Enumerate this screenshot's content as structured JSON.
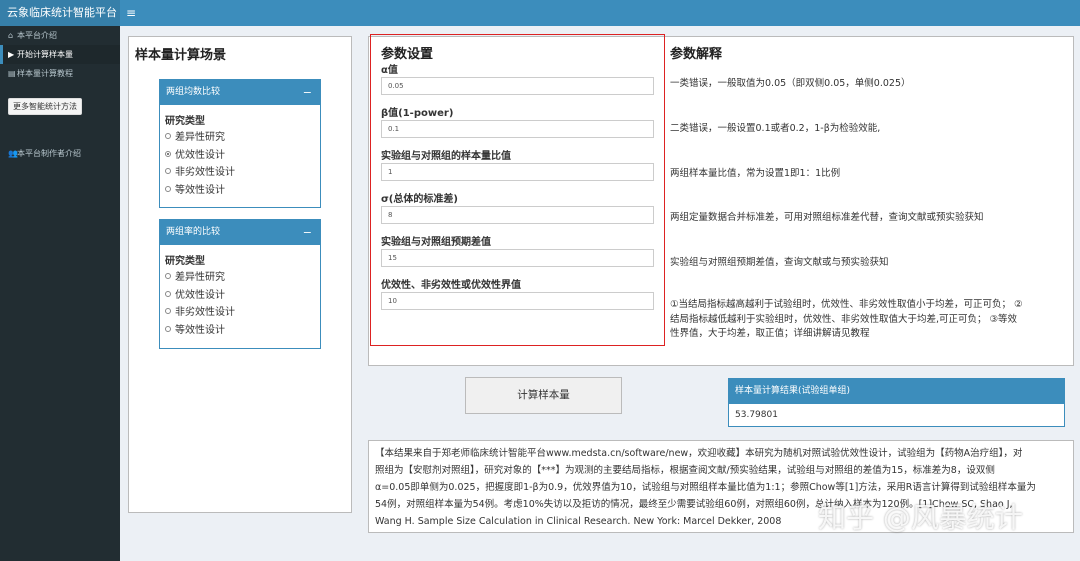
{
  "app": {
    "title": "云象临床统计智能平台",
    "menu_icon": "≡"
  },
  "sidebar": {
    "items": [
      {
        "icon": "⌂",
        "label": "本平台介绍"
      },
      {
        "icon": "▶",
        "label": "开始计算样本量"
      },
      {
        "icon": "▤",
        "label": "样本量计算教程"
      }
    ],
    "more_button": "更多智能统计方法",
    "author": {
      "icon": "👥",
      "label": "本平台制作者介绍"
    }
  },
  "scenario": {
    "title": "样本量计算场景",
    "box1": {
      "header": "两组均数比较",
      "study_type_label": "研究类型",
      "options": [
        "差异性研究",
        "优效性设计",
        "非劣效性设计",
        "等效性设计"
      ],
      "selected": 1
    },
    "box2": {
      "header": "两组率的比较",
      "study_type_label": "研究类型",
      "options": [
        "差异性研究",
        "优效性设计",
        "非劣效性设计",
        "等效性设计"
      ],
      "selected": -1
    }
  },
  "params": {
    "title": "参数设置",
    "fields": [
      {
        "label": "α值",
        "value": "0.05"
      },
      {
        "label": "β值(1-power)",
        "value": "0.1"
      },
      {
        "label": "实验组与对照组的样本量比值",
        "value": "1"
      },
      {
        "label": "σ(总体的标准差)",
        "value": "8"
      },
      {
        "label": "实验组与对照组预期差值",
        "value": "15"
      },
      {
        "label": "优效性、非劣效性或优效性界值",
        "value": "10"
      }
    ]
  },
  "explain": {
    "title": "参数解释",
    "items": [
      "一类错误，一般取值为0.05（即双侧0.05，单侧0.025）",
      "二类错误，一般设置0.1或者0.2，1-β为检验效能,",
      "两组样本量比值，常为设置1即1：1比例",
      "两组定量数据合并标准差，可用对照组标准差代替，查询文献或预实验获知",
      "实验组与对照组预期差值，查询文献或与预实验获知"
    ],
    "note_lines": [
      "①当结局指标越高越利于试验组时，优效性、非劣效性取值小于均差，可正可负； ②",
      "结局指标越低越利于实验组时，优效性、非劣效性取值大于均差,可正可负； ③等效",
      "性界值，大于均差，取正值；详细讲解请见教程"
    ]
  },
  "calc_button": "计算样本量",
  "result": {
    "header": "样本量计算结果(试验组单组)",
    "value": "53.79801"
  },
  "summary_lines": [
    "【本结果来自于郑老师临床统计智能平台www.medsta.cn/software/new，欢迎收藏】本研究为随机对照试验优效性设计，试验组为【药物A治疗组】，对",
    "照组为【安慰剂对照组】，研究对象的【***】为观测的主要结局指标，根据查阅文献/预实验结果，试验组与对照组的差值为15，标准差为8，设双侧",
    "α=0.05即单侧为0.025，把握度即1-β为0.9，优效界值为10，试验组与对照组样本量比值为1:1；参照Chow等[1]方法，采用R语言计算得到试验组样本量为",
    "54例，对照组样本量为54例。考虑10%失访以及拒访的情况，最终至少需要试验组60例，对照组60例，总计纳入样本为120例。[1]Chow SC, Shao J,",
    "Wang H. Sample Size Calculation in Clinical Research. New York: Marcel Dekker, 2008"
  ],
  "watermark": "知乎 @风暴统计"
}
